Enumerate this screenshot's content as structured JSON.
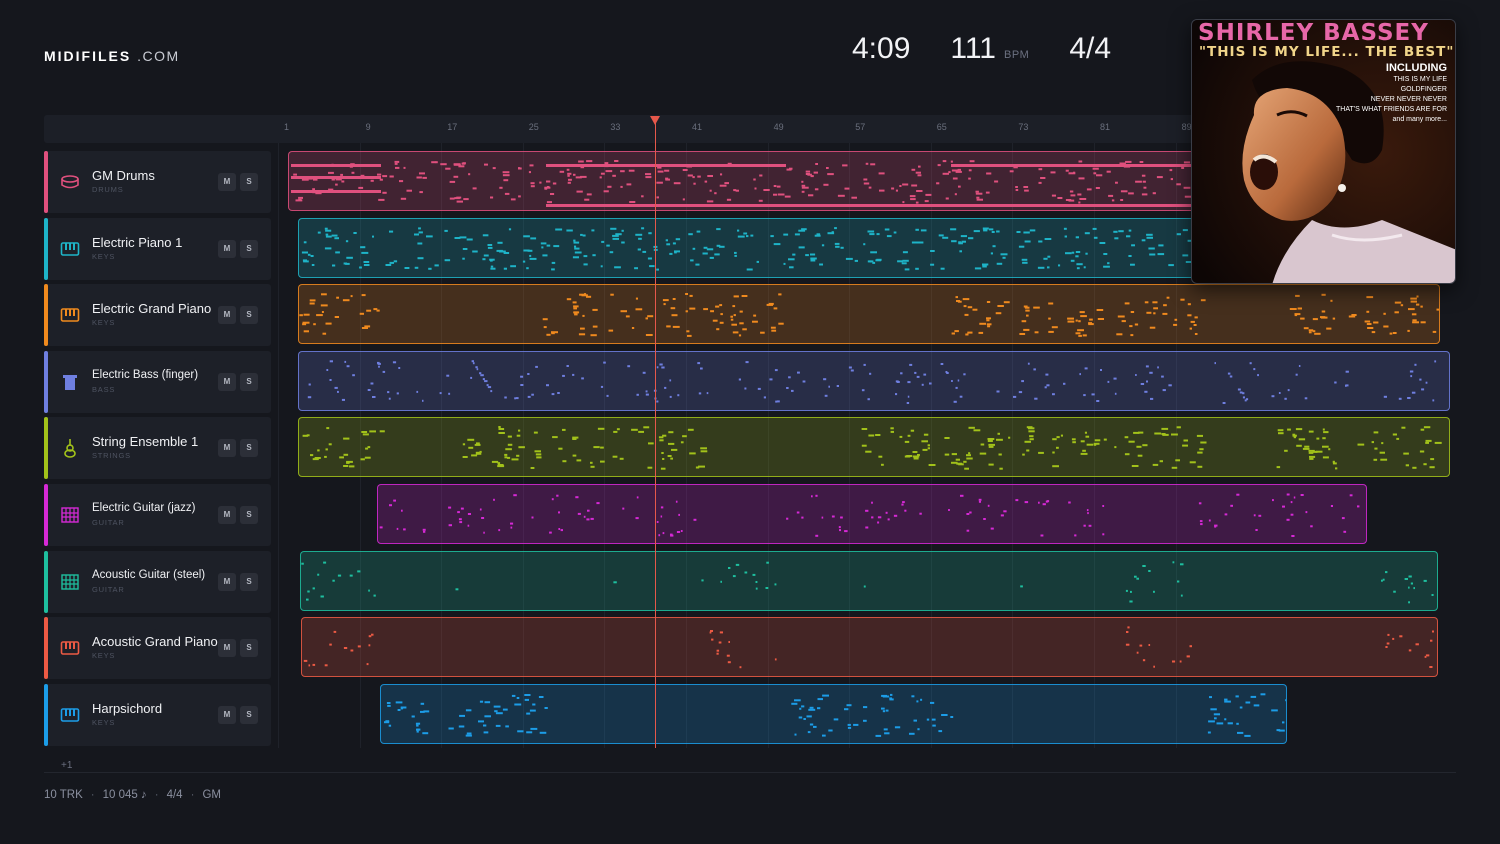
{
  "brand": {
    "name": "MIDIFILES",
    "suffix": ".COM"
  },
  "stats": {
    "duration": "4:09",
    "tempo": "111",
    "tempo_unit": "BPM",
    "time_signature": "4/4"
  },
  "album": {
    "artist": "SHIRLEY BASSEY",
    "title": "\"THIS IS MY LIFE... THE BEST\"",
    "including": "INCLUDING",
    "songs": [
      "THIS IS MY LIFE",
      "GOLDFINGER",
      "NEVER NEVER NEVER",
      "THAT'S WHAT FRIENDS ARE FOR",
      "and many more..."
    ]
  },
  "ruler": {
    "bars": [
      "1",
      "9",
      "17",
      "25",
      "33",
      "41",
      "49",
      "57",
      "65",
      "73",
      "81",
      "89"
    ]
  },
  "playhead_bar": 37,
  "tracks": [
    {
      "name": "GM Drums",
      "category": "DRUMS",
      "color": "#e0507e",
      "icon": "drum-icon",
      "mute": "M",
      "solo": "S"
    },
    {
      "name": "Electric Piano 1",
      "category": "KEYS",
      "color": "#1eb4c8",
      "icon": "piano-icon",
      "mute": "M",
      "solo": "S"
    },
    {
      "name": "Electric Grand Piano",
      "category": "KEYS",
      "color": "#f08a1e",
      "icon": "piano-icon",
      "mute": "M",
      "solo": "S"
    },
    {
      "name": "Electric Bass (finger)",
      "category": "BASS",
      "color": "#6f7fe0",
      "icon": "bass-icon",
      "mute": "M",
      "solo": "S"
    },
    {
      "name": "String Ensemble 1",
      "category": "STRINGS",
      "color": "#a2c21a",
      "icon": "violin-icon",
      "mute": "M",
      "solo": "S"
    },
    {
      "name": "Electric Guitar (jazz)",
      "category": "GUITAR",
      "color": "#d629d6",
      "icon": "guitar-fret-icon",
      "mute": "M",
      "solo": "S"
    },
    {
      "name": "Acoustic Guitar (steel)",
      "category": "GUITAR",
      "color": "#1ebf9f",
      "icon": "guitar-fret-icon",
      "mute": "M",
      "solo": "S"
    },
    {
      "name": "Acoustic Grand Piano",
      "category": "KEYS",
      "color": "#ec5a44",
      "icon": "piano-icon",
      "mute": "M",
      "solo": "S"
    },
    {
      "name": "Harpsichord",
      "category": "KEYS",
      "color": "#1c9de8",
      "icon": "piano-icon",
      "mute": "M",
      "solo": "S"
    }
  ],
  "more_tracks": "+1",
  "footer": {
    "tracks": "10 TRK",
    "notes": "10 045 ♪",
    "time_signature": "4/4",
    "standard": "GM"
  }
}
